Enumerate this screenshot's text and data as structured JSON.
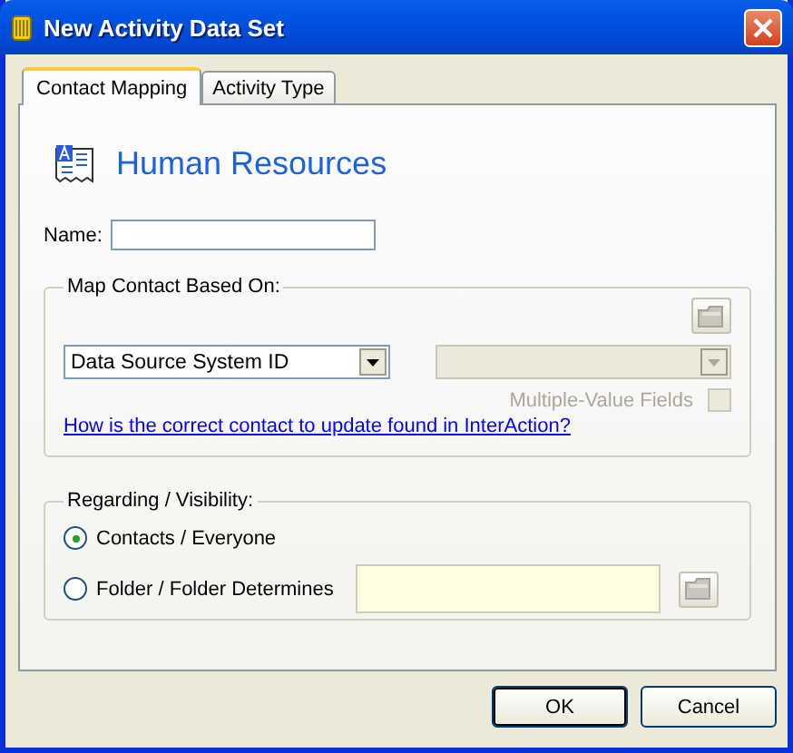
{
  "window": {
    "title": "New Activity Data Set"
  },
  "tabs": [
    {
      "label": "Contact Mapping",
      "selected": true
    },
    {
      "label": "Activity Type",
      "selected": false
    }
  ],
  "header": {
    "title": "Human Resources"
  },
  "name_field": {
    "label": "Name:"
  },
  "map_contact": {
    "title": "Map Contact Based On:",
    "field_combo": {
      "value": "Data Source System ID"
    },
    "second_combo": {
      "disabled": true
    },
    "multi_value": {
      "label": "Multiple-Value Fields",
      "checked": false,
      "disabled": true
    },
    "help_link": "How is the correct contact to update found in InterAction?"
  },
  "regarding": {
    "title": "Regarding / Visibility:",
    "options": [
      {
        "label": "Contacts / Everyone",
        "selected": true
      },
      {
        "label": "Folder / Folder Determines",
        "selected": false
      }
    ]
  },
  "buttons": [
    {
      "label": "OK",
      "default": true
    },
    {
      "label": "Cancel",
      "default": false
    }
  ]
}
